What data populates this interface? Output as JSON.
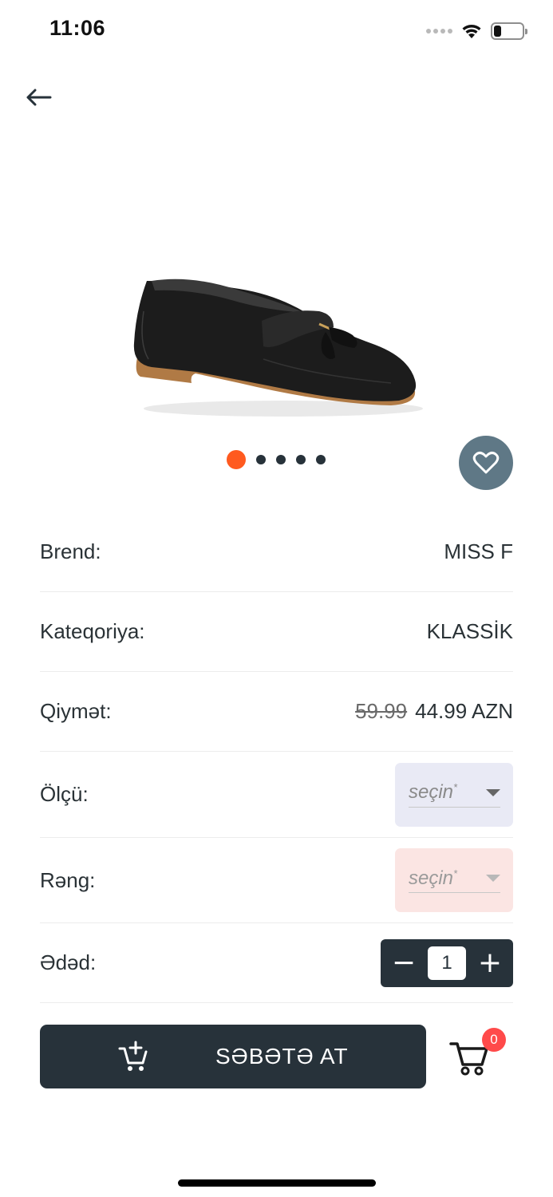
{
  "status_bar": {
    "time": "11:06"
  },
  "product": {
    "image_alt": "black tassel loafer",
    "carousel": {
      "total": 5,
      "active": 0
    },
    "brand": {
      "label": "Brend:",
      "value": "MISS F"
    },
    "category": {
      "label": "Kateqoriya:",
      "value": "KLASSİK"
    },
    "price": {
      "label": "Qiymət:",
      "old": "59.99",
      "current": "44.99 AZN"
    },
    "size": {
      "label": "Ölçü:",
      "placeholder": "seçin",
      "required_mark": "*"
    },
    "color": {
      "label": "Rəng:",
      "placeholder": "seçin",
      "required_mark": "*"
    },
    "quantity": {
      "label": "Ədəd:",
      "value": "1",
      "minus": "−",
      "plus": "+"
    }
  },
  "actions": {
    "add_to_cart_label": "SƏBƏTƏ AT",
    "cart_count": "0"
  },
  "colors": {
    "accent": "#ff5a1f",
    "dark": "#27323a",
    "favorite_bg": "#5f7886",
    "badge": "#ff4a4a"
  },
  "icons": {
    "back": "arrow-left-icon",
    "favorite": "heart-icon",
    "add_cart": "cart-plus-icon",
    "cart": "shopping-cart-icon"
  }
}
